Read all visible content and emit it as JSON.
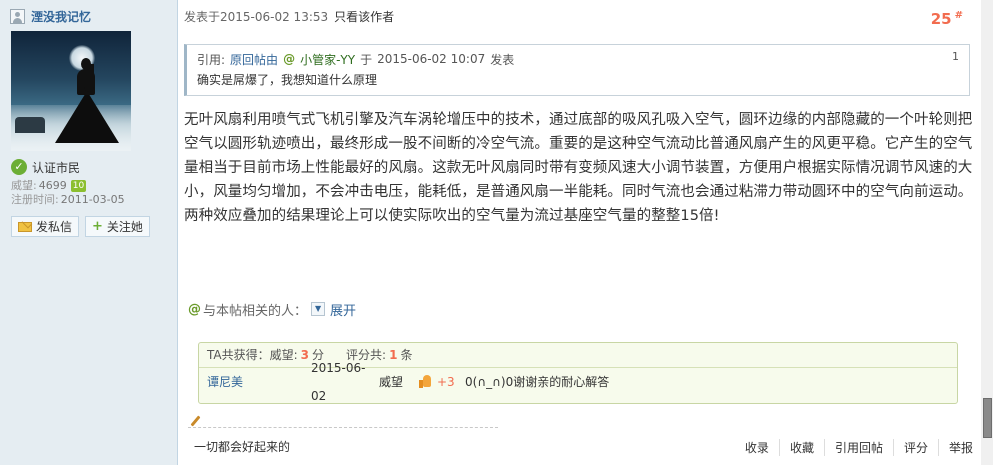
{
  "user": {
    "name": "湮没我记忆",
    "badge": "认证市民",
    "prestige_label": "威望:",
    "prestige_value": "4699",
    "level": "10",
    "reg_label": "注册时间:",
    "reg_date": "2011-03-05",
    "pm_button": "发私信",
    "follow_button": "关注她"
  },
  "post": {
    "posted_at": "发表于2015-06-02 13:53",
    "only_author": "只看该作者",
    "floor": "25",
    "floor_suffix": "#",
    "quote": {
      "prefix": "引用:",
      "source_link": "原回帖由",
      "user": "小管家-YY",
      "conj": "于",
      "date": "2015-06-02 10:07",
      "verb": "发表",
      "index": "1",
      "body": "确实是屌爆了，我想知道什么原理"
    },
    "content": "无叶风扇利用喷气式飞机引擎及汽车涡轮增压中的技术，通过底部的吸风孔吸入空气，圆环边缘的内部隐藏的一个叶轮则把空气以圆形轨迹喷出，最终形成一股不间断的冷空气流。重要的是这种空气流动比普通风扇产生的风更平稳。它产生的空气量相当于目前市场上性能最好的风扇。这款无叶风扇同时带有变频风速大小调节装置，方便用户根据实际情况调节风速的大小，风量均匀增加，不会冲击电压，能耗低，是普通风扇一半能耗。同时气流也会通过粘滞力带动圆环中的空气向前运动。两种效应叠加的结果理论上可以使实际吹出的空气量为流过基座空气量的整整15倍!",
    "related_label": "与本帖相关的人：",
    "expand_label": "展开",
    "rating": {
      "head_prefix": "TA共获得：",
      "prestige_label": "威望:",
      "prestige_value": "3",
      "unit1": "分",
      "count_label": "评分共:",
      "count_value": "1",
      "unit2": "条",
      "rows": [
        {
          "rater": "谭尼美",
          "date": "2015-06-02",
          "type": "威望",
          "points": "+3",
          "reason": "0(∩_∩)0谢谢亲的耐心解答"
        }
      ]
    },
    "signature": "一切都会好起来的",
    "actions": [
      "收录",
      "收藏",
      "引用回帖",
      "评分",
      "举报"
    ]
  }
}
